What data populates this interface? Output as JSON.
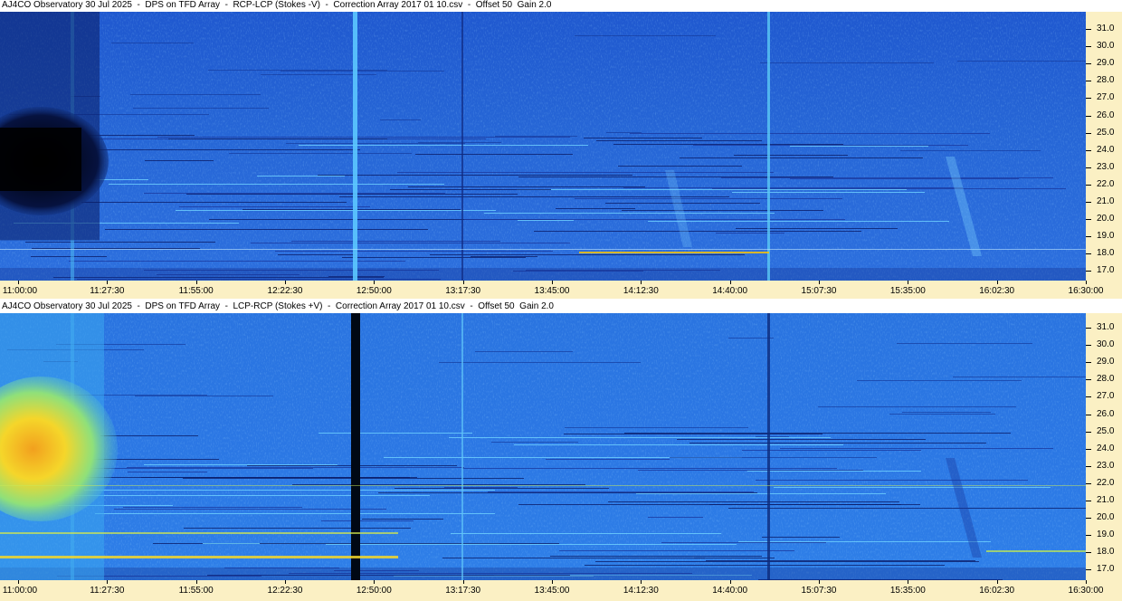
{
  "colors": {
    "axis_background": "#fbf0c4",
    "spectrum_base": "#2e6fd8",
    "strong_emission": "#f4c20d",
    "dark_band": "#000814"
  },
  "panels": [
    {
      "title": "AJ4CO Observatory 30 Jul 2025  -  DPS on TFD Array  -  RCP-LCP (Stokes -V)  -  Correction Array 2017 01 10.csv  -  Offset 50  Gain 2.0",
      "polarity": "negative"
    },
    {
      "title": "AJ4CO Observatory 30 Jul 2025  -  DPS on TFD Array  -  LCP-RCP (Stokes +V)  -  Correction Array 2017 01 10.csv  -  Offset 50  Gain 2.0",
      "polarity": "positive"
    }
  ],
  "frequency_ticks": [
    "31.0",
    "30.0",
    "29.0",
    "28.0",
    "27.0",
    "26.0",
    "25.0",
    "24.0",
    "23.0",
    "22.0",
    "21.0",
    "20.0",
    "19.0",
    "18.0",
    "17.0"
  ],
  "time_ticks": [
    "11:00:00",
    "11:27:30",
    "11:55:00",
    "12:22:30",
    "12:50:00",
    "13:17:30",
    "13:45:00",
    "14:12:30",
    "14:40:00",
    "15:07:30",
    "15:35:00",
    "16:02:30",
    "16:30:00"
  ]
}
